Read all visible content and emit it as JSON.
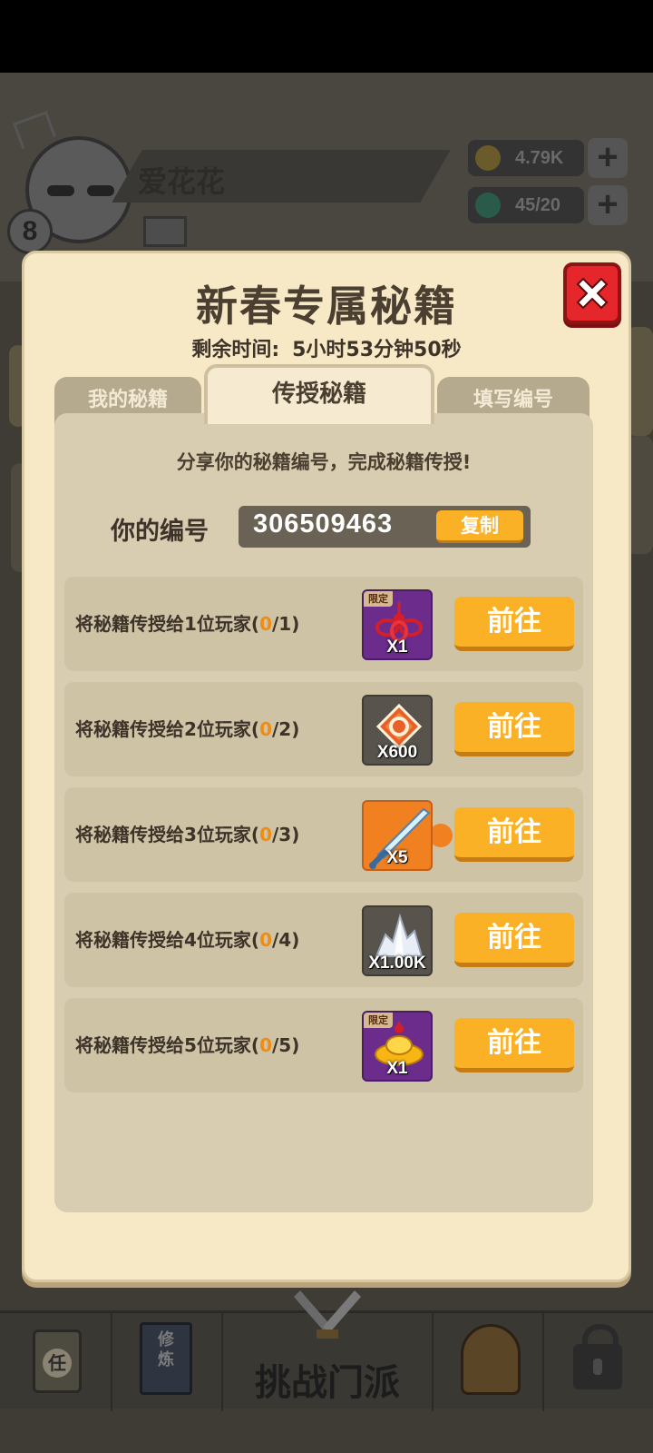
{
  "background": {
    "player_name": "爱花花",
    "player_level": "8",
    "resources": [
      {
        "icon": "coin-icon",
        "value": "4.79K"
      },
      {
        "icon": "jade-icon",
        "value": "45/20"
      }
    ]
  },
  "bottom_nav": {
    "task_label": "任",
    "book_label": "修炼",
    "center_label": "挑战门派"
  },
  "modal": {
    "title": "新春专属秘籍",
    "timer_label": "剩余时间:",
    "timer_value": "5小时53分钟50秒",
    "tabs": [
      {
        "label": "我的秘籍",
        "active": false
      },
      {
        "label": "传授秘籍",
        "active": true
      },
      {
        "label": "填写编号",
        "active": false
      }
    ],
    "share_text": "分享你的秘籍编号，完成秘籍传授!",
    "code_label": "你的编号",
    "code_value": "306509463",
    "copy_label": "复制",
    "tasks": [
      {
        "prefix": "将秘籍传授给1位玩家(",
        "current": "0",
        "suffix": "/1)",
        "reward_qty": "X1",
        "reward_icon": "knot-icon",
        "limited": "限定",
        "action": "前往"
      },
      {
        "prefix": "将秘籍传授给2位玩家(",
        "current": "0",
        "suffix": "/2)",
        "reward_qty": "X600",
        "reward_icon": "honor-badge-icon",
        "action": "前往"
      },
      {
        "prefix": "将秘籍传授给3位玩家(",
        "current": "0",
        "suffix": "/3)",
        "reward_qty": "X5",
        "reward_icon": "sword-fragment-icon",
        "action": "前往"
      },
      {
        "prefix": "将秘籍传授给4位玩家(",
        "current": "0",
        "suffix": "/4)",
        "reward_qty": "X1.00K",
        "reward_icon": "crystal-icon",
        "action": "前往"
      },
      {
        "prefix": "将秘籍传授给5位玩家(",
        "current": "0",
        "suffix": "/5)",
        "reward_qty": "X1",
        "reward_icon": "gold-ingot-icon",
        "limited": "限定",
        "action": "前往"
      }
    ]
  },
  "colors": {
    "accent_orange": "#fbb125",
    "progress_orange": "#f08c13",
    "close_red": "#e5262b",
    "modal_bg": "#f7e8c6"
  }
}
